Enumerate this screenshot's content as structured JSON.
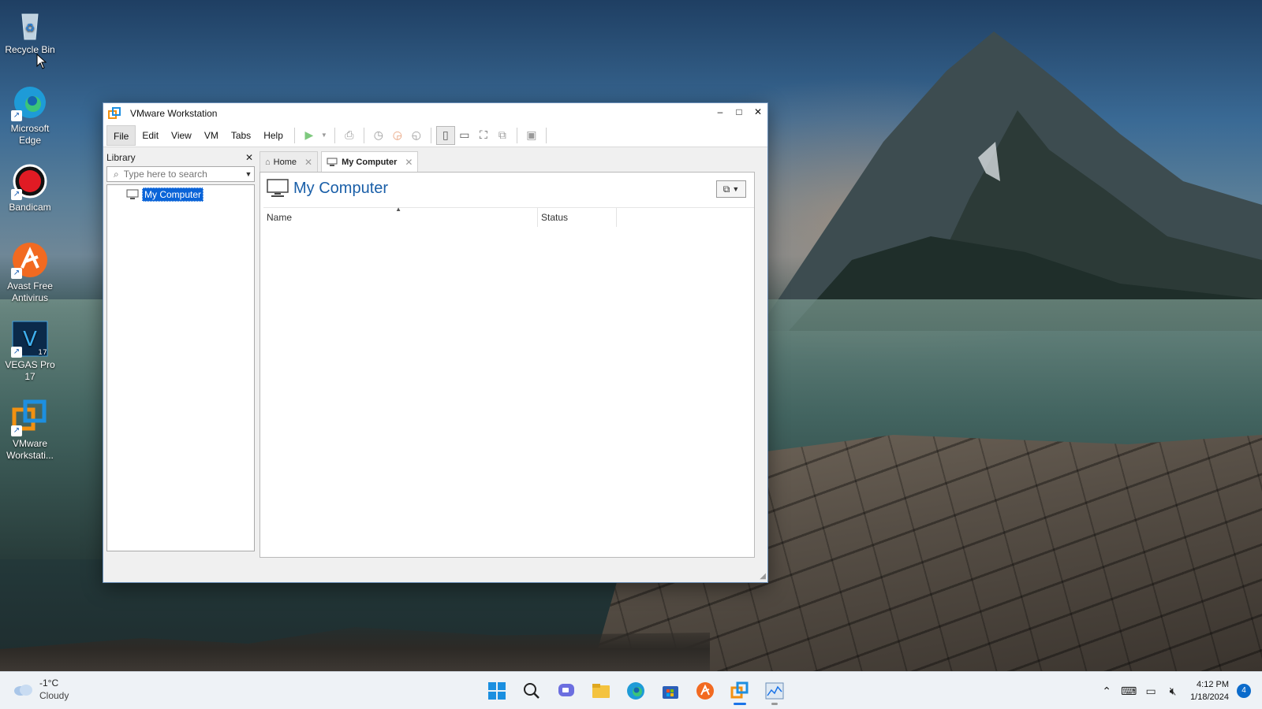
{
  "desktop": {
    "icons": [
      {
        "label": "Recycle Bin",
        "icon": "recycle-bin-icon"
      },
      {
        "label": "Microsoft Edge",
        "icon": "edge-icon"
      },
      {
        "label": "Bandicam",
        "icon": "bandicam-icon"
      },
      {
        "label": "Avast Free Antivirus",
        "icon": "avast-icon"
      },
      {
        "label": "VEGAS Pro 17",
        "icon": "vegas-icon"
      },
      {
        "label": "VMware Workstati...",
        "icon": "vmware-icon"
      }
    ]
  },
  "window": {
    "title": "VMware Workstation",
    "menu": [
      "File",
      "Edit",
      "View",
      "VM",
      "Tabs",
      "Help"
    ],
    "library": {
      "title": "Library",
      "search_placeholder": "Type here to search",
      "tree": [
        {
          "label": "My Computer",
          "selected": true
        }
      ]
    },
    "tabs": [
      {
        "label": "Home",
        "icon": "home-icon",
        "active": false
      },
      {
        "label": "My Computer",
        "icon": "monitor-icon",
        "active": true
      }
    ],
    "pane": {
      "title": "My Computer",
      "columns": [
        "Name",
        "Status"
      ]
    }
  },
  "taskbar": {
    "weather": {
      "temp": "-1°C",
      "condition": "Cloudy"
    },
    "apps": [
      "start-icon",
      "search-icon",
      "chat-icon",
      "file-explorer-icon",
      "edge-icon",
      "store-icon",
      "avast-icon",
      "vmware-icon",
      "chart-app-icon"
    ],
    "clock": {
      "time": "4:12 PM",
      "date": "1/18/2024"
    },
    "notifications": "4"
  },
  "colors": {
    "accent": "#0a64d8",
    "title_blue": "#1a5fa8"
  }
}
